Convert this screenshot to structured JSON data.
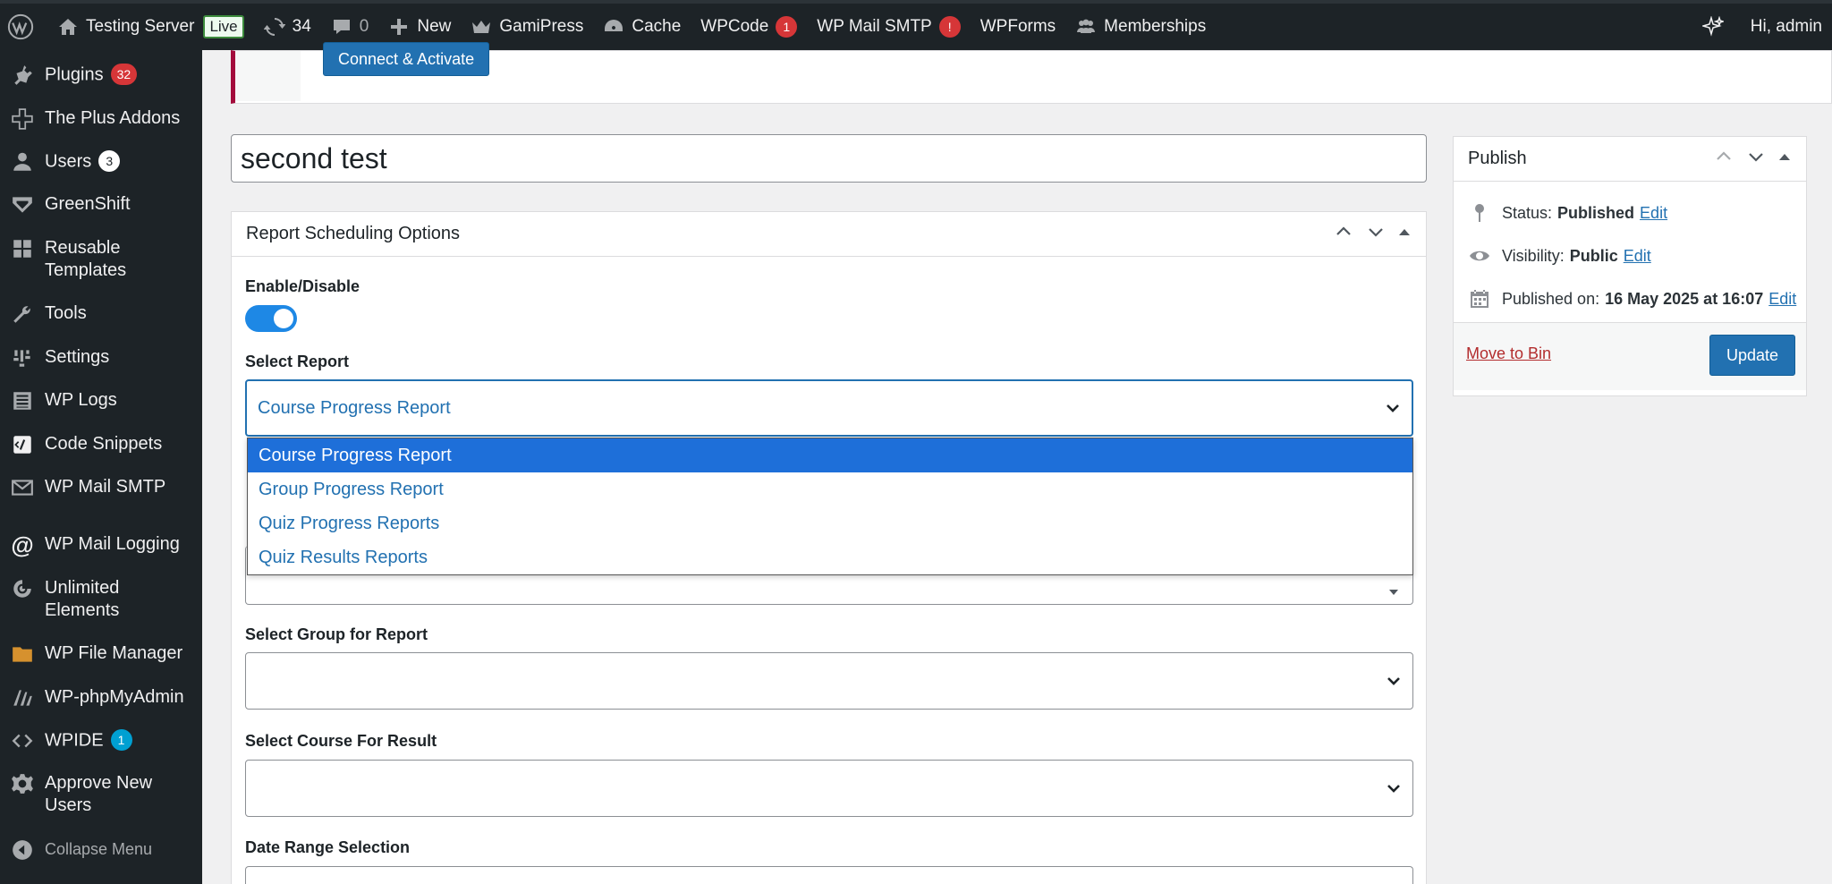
{
  "adminbar": {
    "site_name": "Testing Server",
    "live_label": "Live",
    "updates_count": "34",
    "comments_count": "0",
    "new_label": "New",
    "gamipress": "GamiPress",
    "cache": "Cache",
    "wpcode": "WPCode",
    "wpcode_badge": "1",
    "wpmailsmtp": "WP Mail SMTP",
    "wpmailsmtp_badge": "!",
    "wpforms": "WPForms",
    "memberships": "Memberships",
    "greeting": "Hi, admin"
  },
  "sidebar": {
    "items": [
      {
        "label": "Plugins",
        "badge": "32",
        "icon": "plugin-icon"
      },
      {
        "label": "The Plus Addons",
        "icon": "plus-addons-icon"
      },
      {
        "label": "Users",
        "badge": "3",
        "icon": "users-icon"
      },
      {
        "label": "GreenShift",
        "icon": "greenshift-icon"
      },
      {
        "label": "Reusable",
        "label2": "Templates",
        "icon": "blocks-icon"
      },
      {
        "label": "Tools",
        "icon": "wrench-icon"
      },
      {
        "label": "Settings",
        "icon": "settings-icon"
      },
      {
        "label": "WP Logs",
        "icon": "logs-icon"
      },
      {
        "label": "Code Snippets",
        "icon": "code-snippets-icon"
      },
      {
        "label": "WP Mail SMTP",
        "icon": "mail-icon"
      },
      {
        "label": "WP Mail Logging",
        "icon": "at-icon"
      },
      {
        "label": "Unlimited",
        "label2": "Elements",
        "icon": "unlimited-elements-icon"
      },
      {
        "label": "WP File Manager",
        "icon": "folder-icon"
      },
      {
        "label": "WP-phpMyAdmin",
        "icon": "phpmyadmin-icon"
      },
      {
        "label": "WPIDE",
        "badge": "1",
        "icon": "code-icon"
      },
      {
        "label": "Approve New",
        "label2": "Users",
        "icon": "gear-icon"
      }
    ],
    "collapse_label": "Collapse Menu",
    "badge_red": "#d63638",
    "badge_blue": "#00a0d2"
  },
  "notice": {
    "connect_button": "Connect & Activate"
  },
  "post": {
    "title": "second test"
  },
  "scheduling": {
    "title": "Report Scheduling Options",
    "enable_label": "Enable/Disable",
    "select_report_label": "Select Report",
    "select_report_value": "Course Progress Report",
    "report_options": [
      "Course Progress Report",
      "Group Progress Report",
      "Quiz Progress Reports",
      "Quiz Results Reports"
    ],
    "group_label": "Select Group for Report",
    "course_label": "Select Course For Result",
    "date_label": "Date Range Selection"
  },
  "publish": {
    "title": "Publish",
    "status_label": "Status:",
    "status_value": "Published",
    "visibility_label": "Visibility:",
    "visibility_value": "Public",
    "published_label": "Published on:",
    "published_value": "16 May 2025 at 16:07",
    "edit": "Edit",
    "trash": "Move to Bin",
    "update": "Update"
  },
  "colors": {
    "accent": "#2271b1",
    "admin_dark": "#1d2327",
    "selected_option": "#1e6fd9"
  }
}
